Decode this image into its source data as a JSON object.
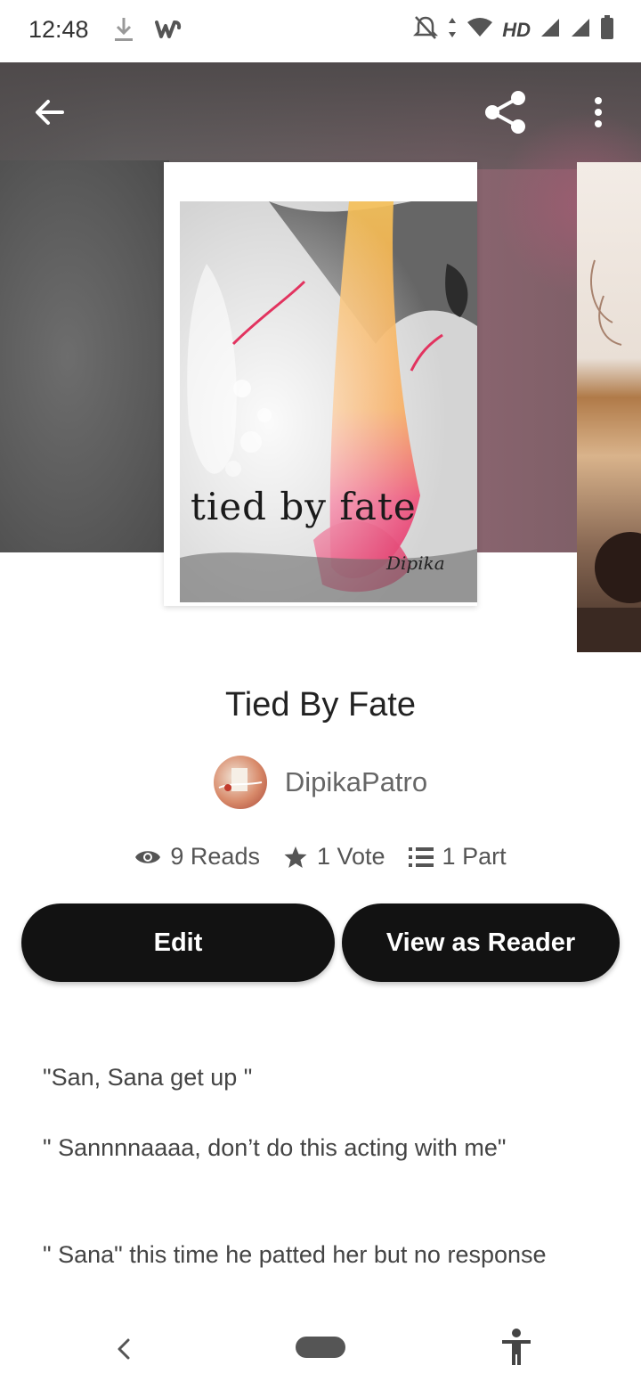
{
  "status_bar": {
    "time": "12:48",
    "network_label": "HD",
    "icons": [
      "download-icon",
      "wattpad-icon",
      "notifications-off-icon",
      "data-arrows-icon",
      "wifi-icon",
      "signal-icon",
      "signal-icon",
      "battery-icon"
    ]
  },
  "header": {
    "back_icon": "arrow-left-icon",
    "share_icon": "share-icon",
    "more_icon": "more-vertical-icon"
  },
  "cover": {
    "title_text": "tied by fate",
    "signature": "Dipika"
  },
  "story": {
    "title": "Tied By Fate",
    "author": "DipikaPatro"
  },
  "stats": {
    "reads": "9 Reads",
    "votes": "1 Vote",
    "parts": "1 Part"
  },
  "actions": {
    "edit_label": "Edit",
    "reader_label": "View as Reader"
  },
  "excerpt": [
    "\"San, Sana get up \"",
    "\" Sannnnaaaa, don’t do this acting with me\"",
    "\" Sana\" this time he patted her but no response"
  ],
  "nav": {
    "back_icon": "nav-back-icon",
    "home_icon": "nav-home-icon",
    "accessibility_icon": "accessibility-icon"
  },
  "colors": {
    "button_bg": "#121212",
    "button_text": "#ffffff",
    "title": "#222222",
    "muted": "#666666"
  }
}
